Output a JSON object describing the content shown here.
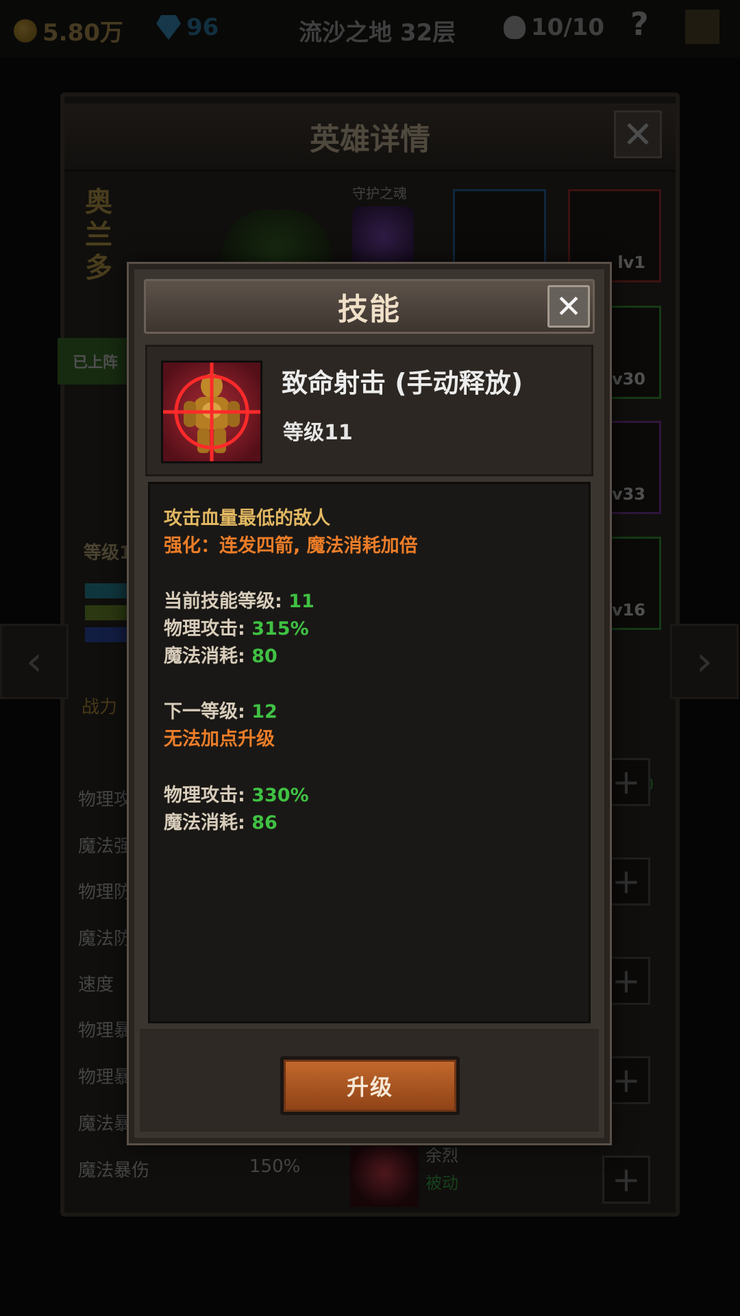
{
  "topbar": {
    "gold": "5.80万",
    "gems": "96",
    "stage": "流沙之地 32层",
    "stamina": "10/10",
    "help": "?"
  },
  "hero_window": {
    "title": "英雄详情",
    "close": "✕",
    "hero_name": "奥兰多",
    "soul_label": "守护之魂",
    "deployed_badge": "已上阵",
    "level": "等级1",
    "power_label": "战力",
    "stats": [
      {
        "label": "物理攻",
        "value": ""
      },
      {
        "label": "魔法强",
        "value": ""
      },
      {
        "label": "物理防",
        "value": ""
      },
      {
        "label": "魔法防",
        "value": ""
      },
      {
        "label": "速度",
        "value": ""
      },
      {
        "label": "物理暴",
        "value": ""
      },
      {
        "label": "物理暴",
        "value": ""
      },
      {
        "label": "魔法暴",
        "value": ""
      },
      {
        "label": "魔法暴伤",
        "value": "150%"
      }
    ],
    "equipment": [
      {
        "level": "",
        "border": "#2a6fb0"
      },
      {
        "level": "lv1",
        "border": "#b03030"
      },
      {
        "level": "lv30",
        "border": "#3aa83a"
      },
      {
        "level": "lv33",
        "border": "#8a3ab0"
      },
      {
        "level": "lv16",
        "border": "#3aa83a"
      }
    ],
    "skill_points": "能点 0",
    "passive_skill": {
      "name": "余烈",
      "type": "被动"
    },
    "nav_prev": "‹",
    "nav_next": "›",
    "plus": "+"
  },
  "skill_dialog": {
    "title": "技能",
    "close": "✕",
    "skill_name": "致命射击 (手动释放)",
    "skill_level": "等级11",
    "description": "攻击血量最低的敌人",
    "enhance": "强化：连发四箭, 魔法消耗加倍",
    "current_level_label": "当前技能等级:",
    "current_level_value": "11",
    "phys_attack_label": "物理攻击:",
    "phys_attack_value": "315%",
    "mana_cost_label": "魔法消耗:",
    "mana_cost_value": "80",
    "next_level_label": "下一等级:",
    "next_level_value": "12",
    "cannot_upgrade": "无法加点升级",
    "next_phys_attack_label": "物理攻击:",
    "next_phys_attack_value": "330%",
    "next_mana_cost_label": "魔法消耗:",
    "next_mana_cost_value": "86",
    "upgrade_button": "升级"
  },
  "colors": {
    "gold_text": "#e2b862",
    "orange_text": "#ec7d28",
    "green_value": "#3fc143",
    "button": "#b05a24"
  }
}
